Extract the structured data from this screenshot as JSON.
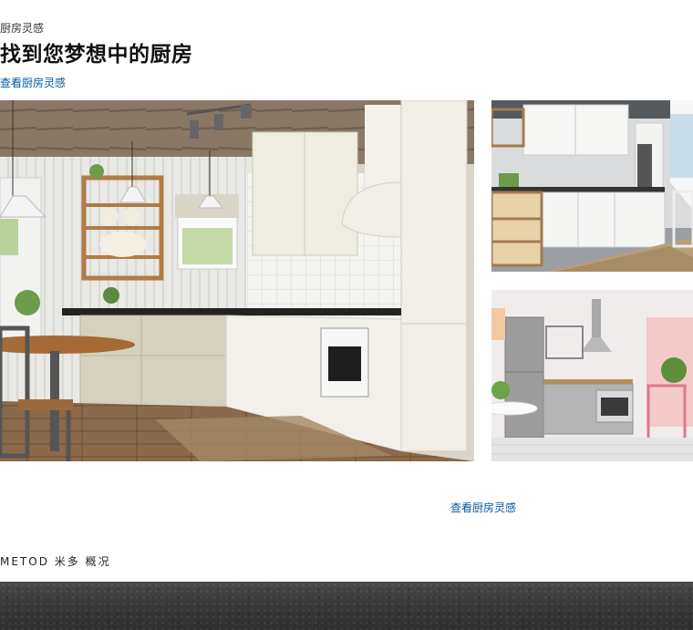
{
  "header": {
    "eyebrow": "厨房灵感",
    "title": "找到您梦想中的厨房",
    "link_label": "查看厨房灵感"
  },
  "gallery": {
    "bottom_link_label": "查看厨房灵感",
    "images": [
      {
        "name": "hero-kitchen-photo",
        "description_icon": "kitchen-photo"
      },
      {
        "name": "white-kitchen-photo",
        "description_icon": "kitchen-photo"
      },
      {
        "name": "stainless-kitchen-photo",
        "description_icon": "kitchen-photo"
      }
    ]
  },
  "section": {
    "heading": "METOD 米多 概况"
  },
  "colors": {
    "link": "#0058a3",
    "banner": "#3b3b3b"
  }
}
